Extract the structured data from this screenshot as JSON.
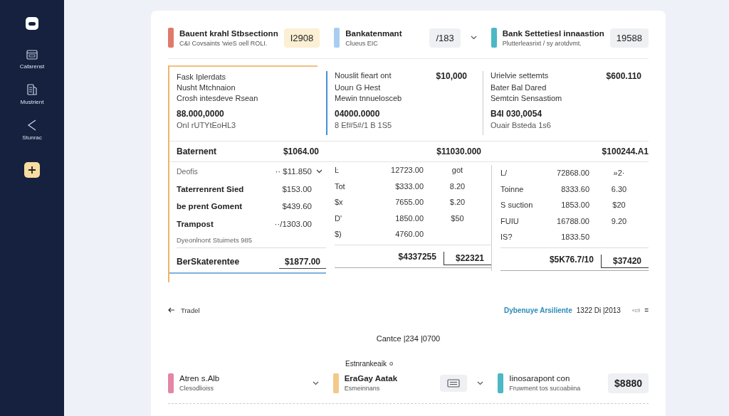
{
  "sidebar": {
    "items": [
      {
        "kind": "calendar",
        "label": "Cafarenst"
      },
      {
        "kind": "document",
        "label": "Mustrient"
      },
      {
        "kind": "back",
        "label": "Stunrac"
      }
    ]
  },
  "summary_cards": [
    {
      "title": "Bauent krahl Stbsectionn",
      "subtitle": "C&I Covsaints 'wieS oell ROLI.",
      "value": "I2908",
      "color": "#e07a6a",
      "highlighted": true,
      "dropdown": false
    },
    {
      "title": "Bankatenmant",
      "subtitle": "Clueus EIC",
      "value": "/183",
      "color": "#a9cdef",
      "highlighted": false,
      "dropdown": true
    },
    {
      "title": "Bank Settetiesl innaastion",
      "subtitle": "Plutterleasrixt / sy arotdvmt.",
      "value": "19588",
      "color": "#4bb8c4",
      "highlighted": false,
      "dropdown": false
    }
  ],
  "accounts": [
    {
      "lines": [
        "Fask Iplerdats",
        "Nusht Mtchnaion",
        "Crosh intesdeve Rsean"
      ],
      "number": "88.000,0000",
      "note": "OnI rUTYtEoHL3"
    },
    {
      "lines": [
        "Nouslit fieart ont",
        "Uourı G Hest",
        "Mewin tnnuelosceb"
      ],
      "amount": "$10,000",
      "number": "04000.0000",
      "note": "8 Ef#5#/1 B 1S5"
    },
    {
      "lines": [
        "Urielvie settemts",
        "Bater Bal Dared",
        "Semtcin Sensastiom"
      ],
      "amount": "$600.110",
      "number": "B4l 030,0054",
      "note": "Ouair Bsteda 1s6"
    }
  ],
  "statement": {
    "left": {
      "title": "Baternent",
      "total": "$1064.00",
      "rows": [
        {
          "kind": "muted",
          "label": "Deofis",
          "amount": "·· $11.850"
        },
        {
          "kind": "bold",
          "label": "Taterrenrent Sied",
          "amount": "$153.00"
        },
        {
          "kind": "bold",
          "label": "be prent Goment",
          "amount": "$439.60"
        },
        {
          "kind": "bold",
          "label": "Trampost",
          "amount": "··/1303.00"
        }
      ],
      "note": "Dyeonlnont Stuimets 985",
      "footer_label": "BerSkaterentee",
      "footer_total": "$1877.00"
    },
    "middle": {
      "total": "$11030.000",
      "rows": [
        [
          "Ŀ",
          "12723.00",
          "got"
        ],
        [
          "Tot",
          "$333.00",
          "8.20"
        ],
        [
          "$x",
          "7655.00",
          "$.20"
        ],
        [
          "D'",
          "1850.00",
          "$50"
        ],
        [
          "$)",
          "4760.00"
        ]
      ],
      "footer_total": "$4337255",
      "footer_extra": "$22321"
    },
    "right": {
      "total": "$100244.A1",
      "rows": [
        [
          "L/",
          "72868.00",
          "»2·"
        ],
        [
          "Toinne",
          "8333.60",
          "6.30"
        ],
        [
          "S suction",
          "1853.00",
          "$20"
        ],
        [
          "FUIU",
          "16788.00",
          "9.20"
        ],
        [
          "IS?",
          "1833.50"
        ]
      ],
      "footer_total": "$5K76.7/10",
      "footer_extra": "$37420"
    }
  },
  "footer": {
    "back": "Tradel",
    "link": "Dybenuye Arsiliente",
    "date": "1322 Di |2013",
    "extra": "«c9",
    "menu": "="
  },
  "count": "Cantce |234 |0700",
  "section_label": "Estnrankeaik",
  "section_mark": "o",
  "bottom_cards": [
    {
      "kind": "dropdown",
      "title": "Atren s.Alb",
      "subtitle": "Clesodlioiss",
      "color": "#e486a8"
    },
    {
      "kind": "icon",
      "title": "EraGay Aatak",
      "subtitle": "Esmeinnans",
      "color": "#f3c98a"
    },
    {
      "kind": "value",
      "title": "Iinosarapont con",
      "subtitle": "Fruwment tos sucoabiina",
      "color": "#4bb8c4",
      "value": "$8880"
    }
  ]
}
